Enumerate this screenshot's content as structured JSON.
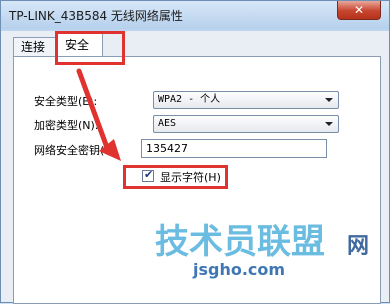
{
  "window": {
    "title": "TP-LINK_43B584 无线网络属性",
    "close_label": "✕"
  },
  "tabs": [
    {
      "label": "连接"
    },
    {
      "label": "安全"
    }
  ],
  "form": {
    "security_type": {
      "label": "安全类型(E):",
      "value": "WPA2 - 个人"
    },
    "encryption_type": {
      "label": "加密类型(N):",
      "value": "AES"
    },
    "network_key": {
      "label": "网络安全密钥(K)",
      "value": "135427"
    },
    "show_chars": {
      "label": "显示字符(H)",
      "checked": true
    }
  },
  "annotations": {
    "highlight_color": "#e0322f"
  },
  "watermark": {
    "text": "jsgho.com",
    "logo_text": "技术员联盟",
    "logo_suffix": "网"
  }
}
